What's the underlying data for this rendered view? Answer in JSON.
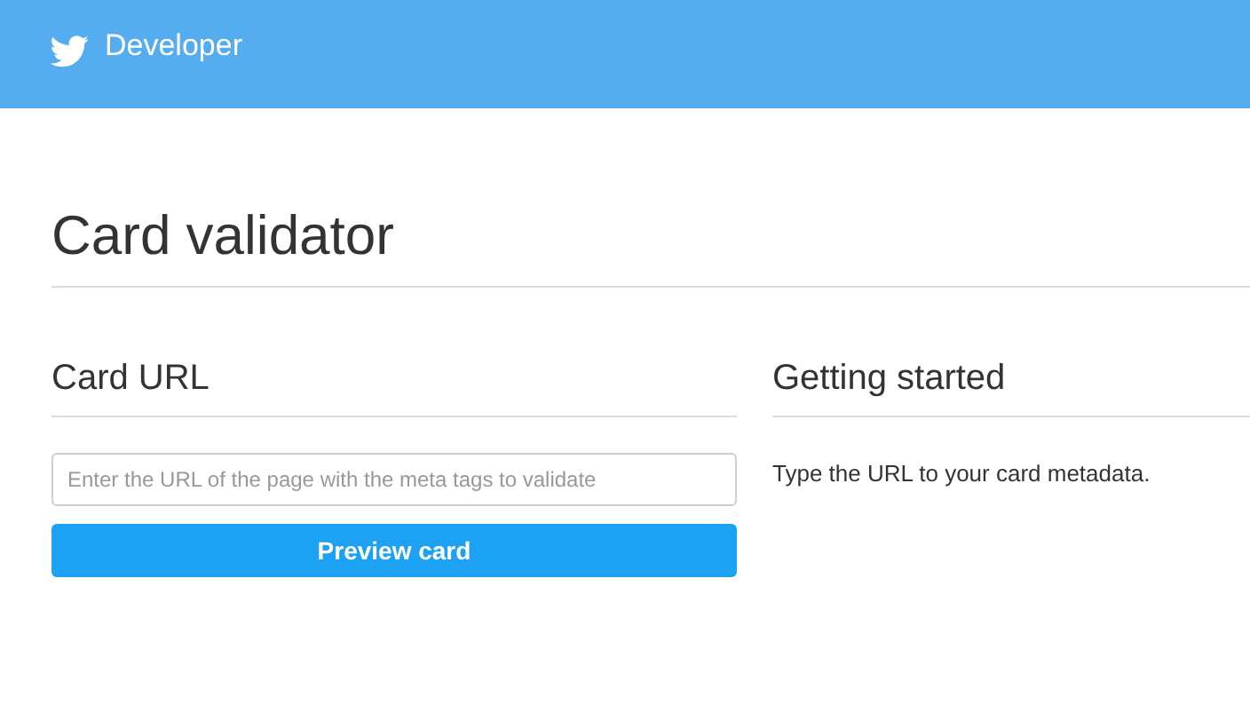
{
  "header": {
    "brand": "Developer"
  },
  "page": {
    "title": "Card validator"
  },
  "card_url": {
    "heading": "Card URL",
    "url_field": {
      "placeholder": "Enter the URL of the page with the meta tags to validate"
    },
    "button": "Preview card"
  },
  "getting_started": {
    "heading": "Getting started",
    "text": "Type the URL to your card metadata."
  }
}
